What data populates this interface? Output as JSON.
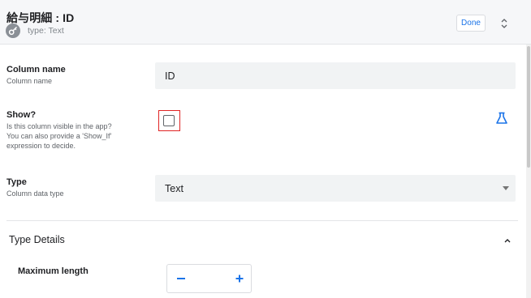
{
  "header": {
    "title": "給与明細 : ID",
    "subtitle": "type: Text",
    "done_label": "Done"
  },
  "fields": {
    "column_name": {
      "label": "Column name",
      "description": "Column name",
      "value": "ID"
    },
    "show": {
      "label": "Show?",
      "description_lines": [
        "Is this column visible in the app?",
        "You can also provide a 'Show_If'",
        "expression to decide."
      ],
      "checked": false
    },
    "type": {
      "label": "Type",
      "description": "Column data type",
      "value": "Text"
    }
  },
  "type_details": {
    "title": "Type Details",
    "max_length_label": "Maximum length"
  },
  "colors": {
    "accent": "#1a73e8",
    "highlight_border": "#e02424"
  },
  "icons": {
    "header_badge": "key-icon",
    "sort": "unfold-icon",
    "expression": "flask-icon",
    "collapse": "chevron-up-icon",
    "decrement": "minus-icon",
    "increment": "plus-icon"
  }
}
